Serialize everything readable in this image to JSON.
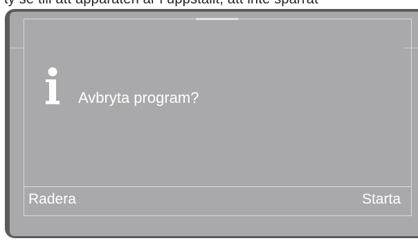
{
  "top_caption": "ty se till att apparaten är i uppställt, att inte spärrat",
  "dialog": {
    "icon": "info-icon",
    "message": "Avbryta program?"
  },
  "softkeys": {
    "left_label": "Radera",
    "right_label": "Starta"
  },
  "colors": {
    "frame": "#5b5b5d",
    "screen": "#a9a9ab",
    "text": "#ffffff",
    "lines": "#dcdcdd"
  }
}
